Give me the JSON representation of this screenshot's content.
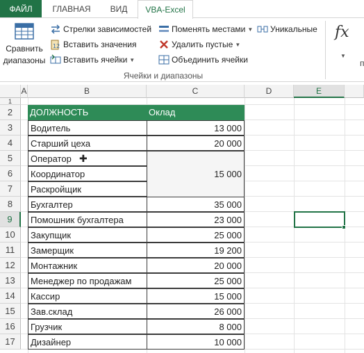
{
  "ribbon": {
    "tabs": [
      "ФАЙЛ",
      "ГЛАВНАЯ",
      "ВИД",
      "VBA-Excel"
    ],
    "compare_ranges": "Сравнить диапазоны",
    "compare_line1": "Сравнить",
    "compare_line2": "диапазоны",
    "dependency_arrows": "Стрелки зависимостей",
    "paste_values": "Вставить значения",
    "insert_cells": "Вставить ячейки",
    "swap": "Поменять местами",
    "delete_empty": "Удалить пустые",
    "merge_cells": "Объединить ячейки",
    "unique": "Уникальные",
    "group_label": "Ячейки и диапазоны",
    "fx": "fx",
    "cut_letter": "п"
  },
  "sheet": {
    "columns": [
      "A",
      "B",
      "C",
      "D",
      "E"
    ],
    "active_column": "E",
    "rows": [
      "1",
      "2",
      "3",
      "4",
      "5",
      "6",
      "7",
      "8",
      "9",
      "10",
      "11",
      "12",
      "13",
      "14",
      "15",
      "16",
      "17"
    ],
    "active_row": "9",
    "header": {
      "position": "ДОЛЖНОСТЬ",
      "salary": "Оклад"
    },
    "entries": [
      {
        "position": "Водитель",
        "salary": "13 000"
      },
      {
        "position": "Старший цеха",
        "salary": "20 000"
      },
      {
        "position": "Оператор",
        "salary": ""
      },
      {
        "position": "Координатор",
        "salary": ""
      },
      {
        "position": "Раскройщик",
        "salary": ""
      },
      {
        "position": "Бухгалтер",
        "salary": "35 000"
      },
      {
        "position": "Помошник бухгалтера",
        "salary": "23 000"
      },
      {
        "position": "Закупщик",
        "salary": "25 000"
      },
      {
        "position": "Замерщик",
        "salary": "19 200"
      },
      {
        "position": "Монтажник",
        "salary": "20 000"
      },
      {
        "position": "Менеджер по продажам",
        "salary": "25 000"
      },
      {
        "position": "Кассир",
        "salary": "15 000"
      },
      {
        "position": "Зав.склад",
        "salary": "26 000"
      },
      {
        "position": "Грузчик",
        "salary": "8 000"
      },
      {
        "position": "Дизайнер",
        "salary": "10 000"
      }
    ],
    "merged_salary": "15 000"
  },
  "colors": {
    "accent": "#217346",
    "header_fill": "#2e8b57"
  }
}
